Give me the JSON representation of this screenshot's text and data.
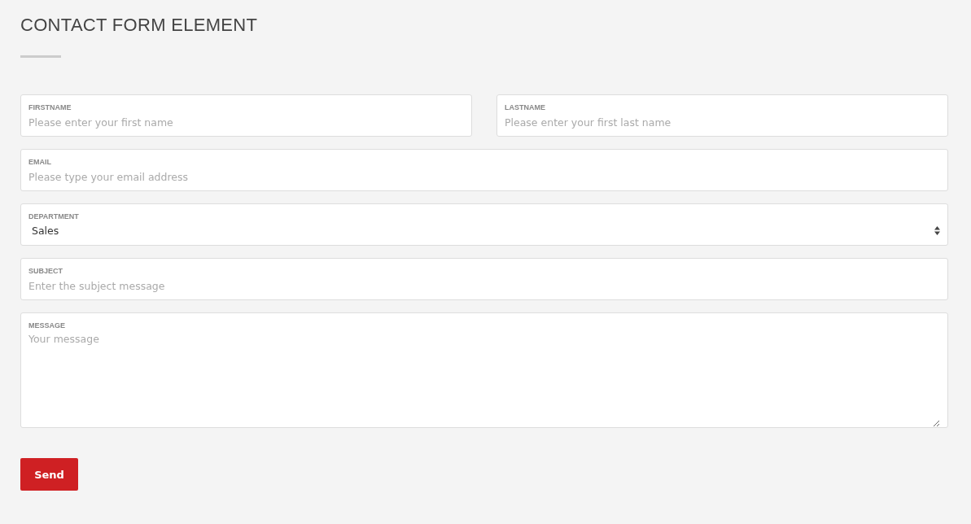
{
  "title": "CONTACT FORM ELEMENT",
  "rows": [
    [
      {
        "kind": "text",
        "label": "FIRSTNAME",
        "placeholder": "Please enter your first name"
      },
      {
        "kind": "text",
        "label": "LASTNAME",
        "placeholder": "Please enter your first last name"
      }
    ],
    [
      {
        "kind": "text",
        "label": "EMAIL",
        "placeholder": "Please type your email address"
      }
    ],
    [
      {
        "kind": "select",
        "label": "DEPARTMENT",
        "value": "Sales"
      }
    ],
    [
      {
        "kind": "text",
        "label": "SUBJECT",
        "placeholder": "Enter the subject message"
      }
    ],
    [
      {
        "kind": "textarea",
        "label": "MESSAGE",
        "placeholder": "Your message"
      }
    ]
  ],
  "button": "Send"
}
